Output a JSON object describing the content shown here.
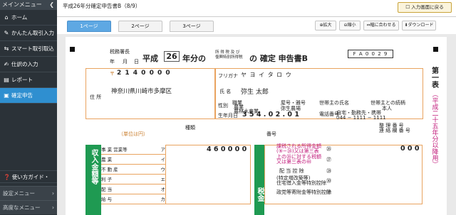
{
  "sidebar": {
    "header": "メインメニュー",
    "items": [
      {
        "label": "ホーム",
        "icon": "home-icon"
      },
      {
        "label": "かんたん取引入力",
        "icon": "pencil-icon"
      },
      {
        "label": "スマート取引取込",
        "icon": "import-icon"
      },
      {
        "label": "仕訳の入力",
        "icon": "edit-icon"
      },
      {
        "label": "レポート",
        "icon": "report-icon"
      },
      {
        "label": "確定申告",
        "icon": "document-icon"
      }
    ],
    "faq": "使い方ガイド・FAQ",
    "settings_menu": "設定メニュー",
    "advanced_menu": "高度なメニュー"
  },
  "header": {
    "title": "平成26年分確定申告書B（8/9）",
    "back_button": "入力画面に戻る"
  },
  "tabs": [
    {
      "label": "1ページ"
    },
    {
      "label": "2ページ"
    },
    {
      "label": "3ページ"
    }
  ],
  "toolbar": {
    "zoom_in": "拡大",
    "zoom_out": "縮小",
    "fit_width": "幅に合わせる",
    "download": "ダウンロード"
  },
  "form": {
    "tax_office": "税務署長",
    "date_parts": [
      "年",
      "月",
      "日"
    ],
    "heisei": "平成",
    "year": "26",
    "title_mid": "年分の",
    "tax_types": "所 得 税 及 び\n復興特別所得税",
    "title_end": "の 確定 申告書B",
    "doc_code": "F A 0 0 2 9",
    "postal_label": "〒",
    "postal_code": "2 1 4  0 0 0 0",
    "address_label": "住 所",
    "address": "神奈川県川崎市多摩区",
    "furigana_label": "フリガナ",
    "furigana": "ヤ ヨ イ    タ ロ ウ",
    "name_label": "氏 名",
    "name": "弥生 太郎",
    "sex_label": "性別",
    "occupation_label": "職業",
    "occupation": "農業\n農林水産業",
    "store_label": "屋号・雅号",
    "store": "弥生農場",
    "householder_label": "世帯主の氏名",
    "relation_label": "世帯主との続柄",
    "relation": "本人",
    "birth_label": "生年月日",
    "birth": "3 5 4 . 0 2 . 0 1",
    "phone_label": "電話番号",
    "phone_type": "自宅・勤務先・携帯",
    "phone": "044 − 1111 − 1111",
    "first_page": "第一表",
    "vertical_note": "（平成二十五年分以降用）",
    "type_label": "種類",
    "unit_label": "（単位は円）",
    "number_label": "番号",
    "income_section": "収入金額等",
    "income_rows": [
      {
        "label": "事 業",
        "sub": "営業等",
        "mark": "ア"
      },
      {
        "label": "",
        "sub": "農 業",
        "mark": "イ"
      },
      {
        "label": "",
        "sub": "不 動 産",
        "mark": "ウ"
      },
      {
        "label": "",
        "sub": "利 子",
        "mark": "エ"
      },
      {
        "label": "",
        "sub": "配 当",
        "mark": "オ"
      },
      {
        "label": "",
        "sub": "給 与",
        "mark": "カ"
      }
    ],
    "income_value": "4 6 0 0 0 0",
    "tax_section": "税金",
    "tax_rows": [
      {
        "label": "課税される所得金額\n(⑨−㉔)又は第三表",
        "mark": "㉖"
      },
      {
        "label": "上の㉖に対する税額\n又は第三表の㊹",
        "mark": "㉗"
      },
      {
        "label": "配 当 控 除",
        "mark": "㉘"
      },
      {
        "label": "(特定増改築等)\n住宅借入金等特別控除",
        "mark": "㉚"
      },
      {
        "label": "政党等寄附金等特別控除",
        "mark": "㉛"
      }
    ],
    "tax_value": "0 0 0",
    "amend_label": "整 理 番 号\n連 絡 欄 番 号"
  }
}
